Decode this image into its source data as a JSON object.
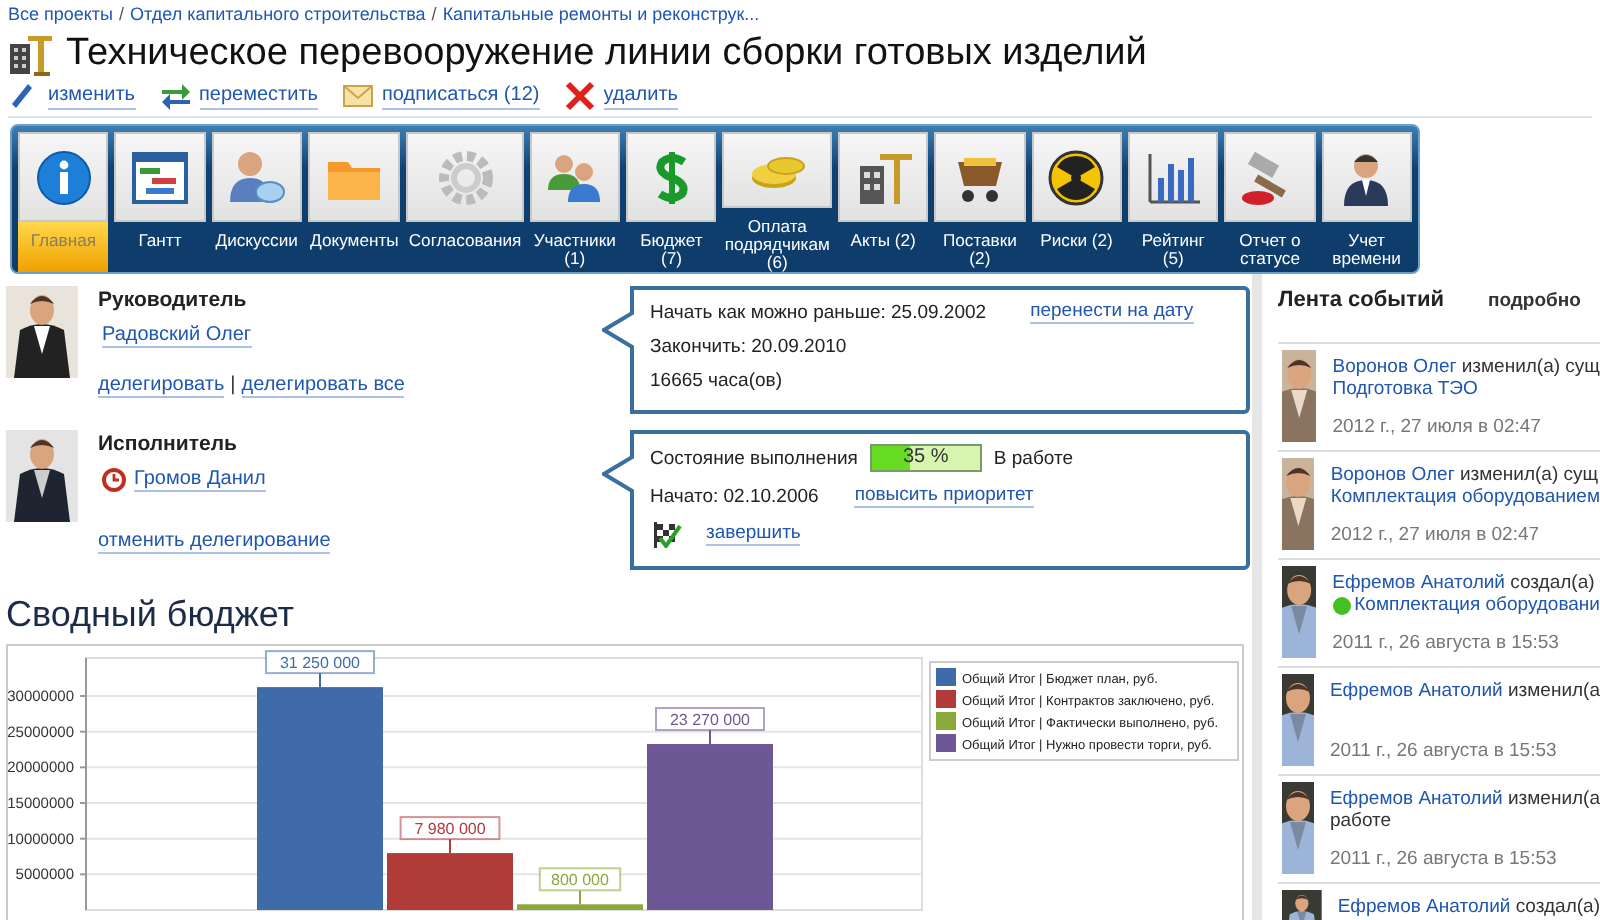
{
  "breadcrumb": {
    "separator": "/",
    "items": [
      "Все проекты",
      "Отдел капитального строительства",
      "Капитальные ремонты и реконструк..."
    ]
  },
  "title": "Техническое перевооружение линии сборки готовых изделий",
  "actions": [
    {
      "label": "изменить"
    },
    {
      "label": "переместить"
    },
    {
      "label": "подписаться (12)"
    },
    {
      "label": "удалить"
    }
  ],
  "toolbar": [
    {
      "label": "Главная",
      "selected": true
    },
    {
      "label": "Гантт",
      "selected": false
    },
    {
      "label": "Дискуссии",
      "selected": false
    },
    {
      "label": "Документы",
      "selected": false
    },
    {
      "label": "Согласования",
      "selected": false
    },
    {
      "label": "Участники (1)",
      "selected": false
    },
    {
      "label": "Бюджет (7)",
      "selected": false
    },
    {
      "label": "Оплата подрядчикам (6)",
      "selected": false
    },
    {
      "label": "Акты (2)",
      "selected": false
    },
    {
      "label": "Поставки (2)",
      "selected": false
    },
    {
      "label": "Риски (2)",
      "selected": false
    },
    {
      "label": "Рейтинг (5)",
      "selected": false
    },
    {
      "label": "Отчет о статусе",
      "selected": false
    },
    {
      "label": "Учет времени",
      "selected": false
    }
  ],
  "manager": {
    "role": "Руководитель",
    "name": "Радовский Олег",
    "links": [
      "делегировать",
      "делегировать все"
    ],
    "separator": "|"
  },
  "executor": {
    "role": "Исполнитель",
    "name": "Громов Данил",
    "links": [
      "отменить делегирование"
    ]
  },
  "schedule": {
    "start": "Начать как можно раньше: 25.09.2002",
    "reschedule_link": "перенести на дату",
    "finish": "Закончить: 20.09.2010",
    "hours": "16665 часа(ов)"
  },
  "progress": {
    "label": "Состояние выполнения",
    "level": 0.35,
    "reading": "35 %",
    "status": "В работе",
    "started": "Начато: 02.10.2006",
    "priority_link": "повысить приоритет",
    "complete_link": "завершить"
  },
  "budget": {
    "title": "Сводный бюджет",
    "chart_data": {
      "type": "bar",
      "data_labels": true,
      "grid": true,
      "legend": true,
      "ylim": [
        0,
        35330000
      ],
      "yticks": [
        5000000,
        10000000,
        15000000,
        20000000,
        25000000,
        30000000
      ],
      "series": [
        {
          "name": "Общий Итог | Бюджет план, руб.",
          "color": "#3f6ca8",
          "values": [
            31250000
          ],
          "value_labels": [
            "31 250 000"
          ]
        },
        {
          "name": "Общий Итог | Контрактов заключено, руб.",
          "color": "#b03c3a",
          "values": [
            7980000
          ],
          "value_labels": [
            "7 980 000"
          ]
        },
        {
          "name": "Общий Итог | Фактически выполнено, руб.",
          "color": "#8aa83c",
          "values": [
            800000
          ],
          "value_labels": [
            "800 000"
          ]
        },
        {
          "name": "Общий Итог | Нужно провести торги, руб.",
          "color": "#6e5795",
          "values": [
            23270000
          ],
          "value_labels": [
            "23 270 000"
          ]
        }
      ]
    }
  },
  "feed": {
    "title": "Лента событий",
    "details_link": "подробно",
    "events": [
      {
        "author": "Воронов Олег",
        "action": "изменил(а) сущ",
        "object": "Подготовка ТЭО",
        "kind": "text",
        "time": "2012 г., 27 июля в 02:47"
      },
      {
        "author": "Воронов Олег",
        "action": "изменил(а) сущ",
        "object": "Комплектация оборудованием",
        "kind": "text",
        "time": "2012 г., 27 июля в 02:47"
      },
      {
        "author": "Ефремов Анатолий",
        "action": "создал(а)",
        "object": "Комплектация оборудовани",
        "kind": "dot",
        "time": "2011 г., 26 августа в 15:53"
      },
      {
        "author": "Ефремов Анатолий",
        "action": "изменил(а",
        "kind": "text",
        "time": "2011 г., 26 августа в 15:53"
      },
      {
        "author": "Ефремов Анатолий",
        "action": "изменил(а",
        "note": "работе",
        "kind": "text",
        "time": "2011 г., 26 августа в 15:53"
      },
      {
        "author": "Ефремов Анатолий",
        "action": "создал(а)",
        "kind": "text"
      }
    ]
  }
}
